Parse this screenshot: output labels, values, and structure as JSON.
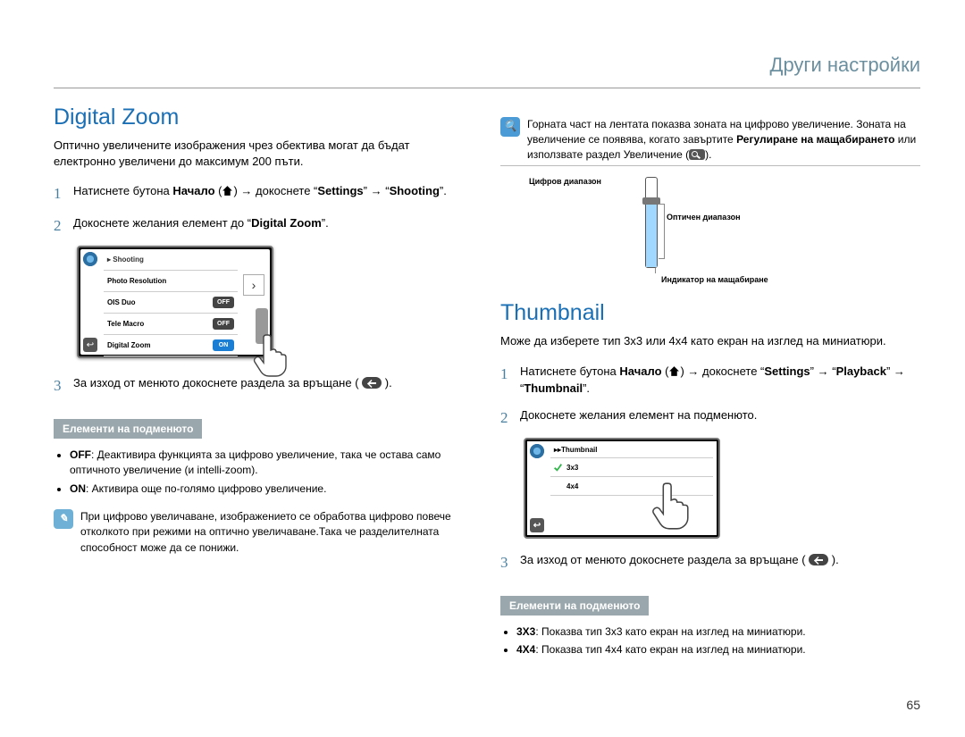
{
  "header": {
    "title": "Други настройки"
  },
  "left": {
    "heading": "Digital Zoom",
    "intro": "Оптично увеличените изображения чрез обектива могат да бъдат електронно увеличени до максимум 200 пъти.",
    "step1_a": "Натиснете бутона ",
    "step1_home": "Начало",
    "step1_b": " → докоснете “",
    "step1_set": "Settings",
    "step1_c": "” → “",
    "step1_shoot": "Shooting",
    "step1_d": "”.",
    "step2_a": "Докоснете желания елемент до “",
    "step2_dz": "Digital Zoom",
    "step2_b": "”.",
    "step3": "За изход от менюто докоснете раздела за връщане (",
    "step3_b": ").",
    "ss": {
      "bc": "Shooting",
      "r1": "Photo Resolution",
      "r2": "OIS Duo",
      "r2v": "OFF",
      "r3": "Tele Macro",
      "r3v": "OFF",
      "r4": "Digital Zoom",
      "r4v": "ON"
    },
    "sub_head": "Елементи на подменюто",
    "sub_off_l": "OFF",
    "sub_off": ": Деактивира функцията за цифрово увеличение, така че остава само оптичното увеличение (и intelli-zoom).",
    "sub_on_l": "ON",
    "sub_on": ": Активира още по-голямо цифрово увеличение.",
    "note": "При цифрово увеличаване, изображението се обработва цифрово повече отколкото при режими на оптично увеличаване.Така че разделителната способност може да се понижи."
  },
  "right": {
    "zoom_note_a": "Горната част на лентата показва зоната на цифрово увеличение. Зоната на увеличение се появява, когато завъртите ",
    "zoom_note_b": "Регулиране на мащабирането",
    "zoom_note_c": " или използвате раздел Увеличение (",
    "zoom_note_d": ").",
    "d_lbl1": "Цифров диапазон",
    "d_opt": "Оптичен диапазон",
    "d_ind": "Индикатор на мащабиране",
    "heading": "Thumbnail",
    "intro": "Може да изберете тип 3x3 или 4x4 като екран на изглед на миниатюри.",
    "step1_a": "Натиснете бутона ",
    "step1_home": "Начало",
    "step1_b": " → докоснете “",
    "step1_set": "Settings",
    "step1_c": "” → “",
    "step1_pb": "Playback",
    "step1_d": "” → “",
    "step1_th": "Thumbnail",
    "step1_e": "”.",
    "step2": "Докоснете желания елемент на подменюто.",
    "step3": "За изход от менюто докоснете раздела за връщане (",
    "step3_b": ").",
    "ss": {
      "bc": "Thumbnail",
      "r1": "3x3",
      "r2": "4x4"
    },
    "sub_head": "Елементи на подменюто",
    "sub_3_l": "3Х3",
    "sub_3": ": Показва тип 3x3 като екран на изглед на миниатюри.",
    "sub_4_l": "4Х4",
    "sub_4": ": Показва тип 4x4 като екран на изглед на миниатюри."
  },
  "page_number": "65"
}
